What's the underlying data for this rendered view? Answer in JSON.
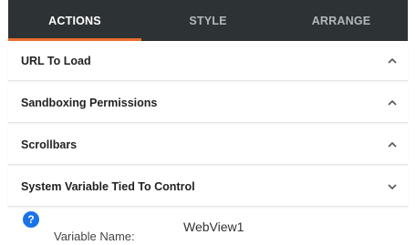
{
  "tabs": [
    {
      "label": "ACTIONS",
      "active": true
    },
    {
      "label": "STYLE",
      "active": false
    },
    {
      "label": "ARRANGE",
      "active": false
    }
  ],
  "sections": [
    {
      "label": "URL To Load",
      "state": "collapsed-up",
      "icon": "chevron-up-icon"
    },
    {
      "label": "Sandboxing Permissions",
      "state": "collapsed-up",
      "icon": "chevron-up-icon"
    },
    {
      "label": "Scrollbars",
      "state": "collapsed-up",
      "icon": "chevron-up-icon"
    },
    {
      "label": "System Variable Tied To Control",
      "state": "expanded",
      "icon": "chevron-down-icon"
    }
  ],
  "variable": {
    "help_icon": "question-mark-icon",
    "help_glyph": "?",
    "label": "Variable Name:",
    "value": "WebView1"
  },
  "colors": {
    "tabbar_bg": "#2d3235",
    "tab_active_underline": "#ec6c2e",
    "help_icon_bg": "#1a73e8"
  }
}
